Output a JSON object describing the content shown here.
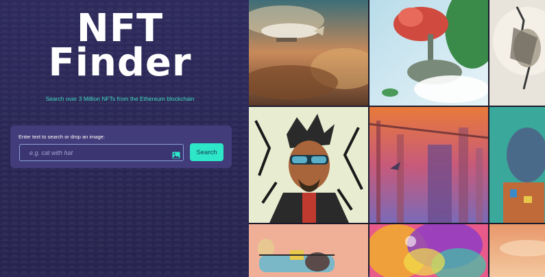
{
  "hero": {
    "title_line1": "NFT",
    "title_line2": "Finder",
    "subtitle": "Search over 3 Million NFTs from the Ethereum blockchain"
  },
  "search": {
    "label": "Enter text to search or drop an image:",
    "placeholder": "e.g. cat with hat",
    "value": "",
    "button_label": "Search",
    "upload_icon": "image-icon"
  },
  "colors": {
    "background": "#2b2856",
    "accent": "#2ee6c8",
    "panel": "#423c7a",
    "subtitle": "#3fe0c4"
  },
  "gallery": {
    "tiles": [
      "airship-over-clouds",
      "floating-island-tree",
      "sketch-figure",
      "cartoon-man-sunglasses",
      "futuristic-city-sunset",
      "robot-portrait",
      "vehicle-cartoon",
      "colorful-face-closeup",
      "peach-sky"
    ]
  }
}
